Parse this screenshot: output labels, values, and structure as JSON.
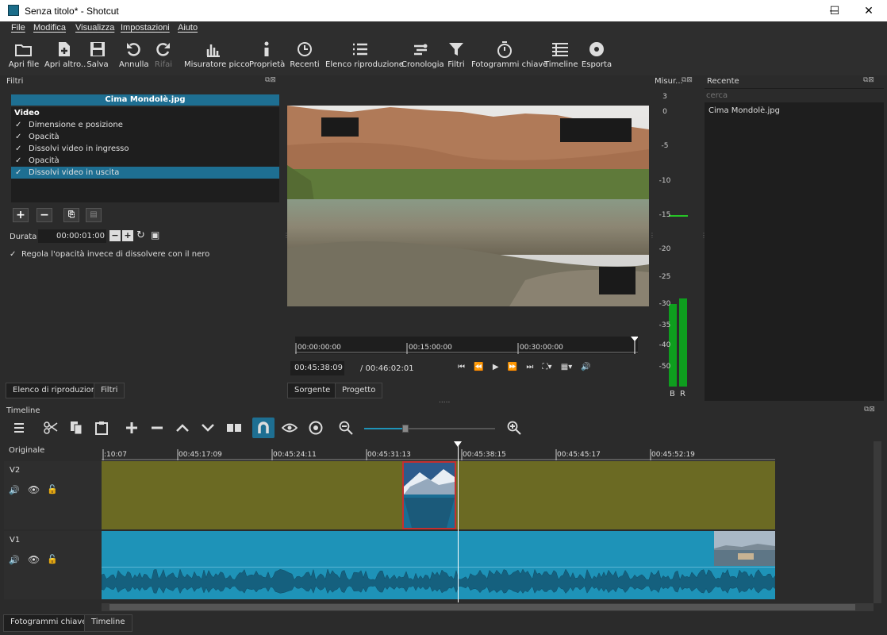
{
  "window": {
    "title": "Senza titolo* - Shotcut",
    "minimize": "─",
    "maximize": "☐",
    "close": "✕"
  },
  "menu": [
    "File",
    "Modifica",
    "Visualizza",
    "Impostazioni",
    "Aiuto"
  ],
  "toolbar": [
    {
      "label": "Apri file",
      "icon": "open-folder-icon"
    },
    {
      "label": "Apri altro..",
      "icon": "open-other-icon"
    },
    {
      "label": "Salva",
      "icon": "save-icon"
    },
    {
      "label": "Annulla",
      "icon": "undo-icon"
    },
    {
      "label": "Rifai",
      "icon": "redo-icon"
    },
    {
      "label": "Misuratore picco",
      "icon": "peak-meter-icon"
    },
    {
      "label": "Proprietà",
      "icon": "info-icon"
    },
    {
      "label": "Recenti",
      "icon": "clock-icon"
    },
    {
      "label": "Elenco riproduzione",
      "icon": "list-icon"
    },
    {
      "label": "Cronologia",
      "icon": "history-icon"
    },
    {
      "label": "Filtri",
      "icon": "filter-icon"
    },
    {
      "label": "Fotogrammi chiave",
      "icon": "stopwatch-icon"
    },
    {
      "label": "Timeline",
      "icon": "timeline-icon"
    },
    {
      "label": "Esporta",
      "icon": "export-disc-icon"
    }
  ],
  "filters_panel": {
    "title": "Filtri",
    "clip_name": "Cima Mondolè.jpg",
    "section": "Video",
    "items": [
      {
        "label": "Dimensione e posizione",
        "check": "✓"
      },
      {
        "label": "Opacità",
        "check": "✓"
      },
      {
        "label": "Dissolvi video in ingresso",
        "check": "✓"
      },
      {
        "label": "Opacità",
        "check": "✓"
      },
      {
        "label": "Dissolvi video in uscita",
        "check": "✓"
      }
    ],
    "duration_label": "Durata",
    "duration_value": "00:00:01:00",
    "option_label": "Regola l'opacità invece di dissolvere con il nero",
    "option_check": "✓",
    "tabs": [
      "Elenco di riproduzione",
      "Filtri"
    ]
  },
  "player": {
    "ruler": [
      "00:00:00:00",
      "00:15:00:00",
      "00:30:00:00"
    ],
    "current_time": "00:45:38:09",
    "total_time": "/ 00:46:02:01",
    "tabs": [
      "Sorgente",
      "Progetto"
    ]
  },
  "meter": {
    "title": "Misur...",
    "ticks": [
      "3",
      "0",
      "-5",
      "-10",
      "-15",
      "-20",
      "-25",
      "-30",
      "-35",
      "-40",
      "-50"
    ],
    "channels": [
      "B",
      "R"
    ],
    "level_left_db": -30,
    "level_right_db": -29
  },
  "recent": {
    "title": "Recente",
    "search_placeholder": "cerca",
    "items": [
      "Cima Mondolè.jpg"
    ]
  },
  "timeline": {
    "title": "Timeline",
    "track_header": "Originale",
    "ruler": [
      ":10:07",
      "00:45:17:09",
      "00:45:24:11",
      "00:45:31:13",
      "00:45:38:15",
      "00:45:45:17",
      "00:45:52:19"
    ],
    "tracks": [
      "V2",
      "V1"
    ],
    "tabs": [
      "Fotogrammi chiave",
      "Timeline"
    ],
    "colors": {
      "v2": "#6b6a23",
      "v1": "#1e93b8",
      "selection": "#c43030"
    }
  }
}
